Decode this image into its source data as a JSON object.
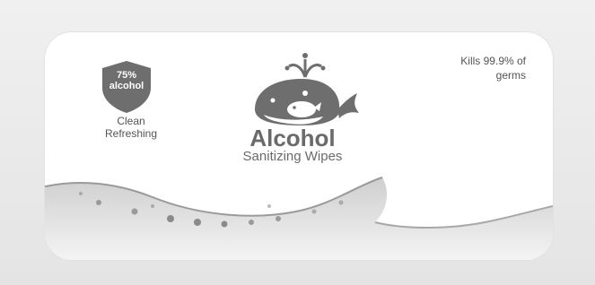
{
  "badge": {
    "line1": "75%",
    "line2": "alcohol",
    "icon": "shield-icon"
  },
  "tagline": {
    "line1": "Clean",
    "line2": "Refreshing"
  },
  "claim": {
    "line1": "Kills 99.9% of",
    "line2": "germs"
  },
  "product": {
    "mascot_icon": "whale-icon",
    "name": "Alcohol",
    "subtitle": "Sanitizing Wipes"
  },
  "colors": {
    "shield": "#6e6e6e",
    "text": "#6a6a6a",
    "background": "#ffffff"
  }
}
